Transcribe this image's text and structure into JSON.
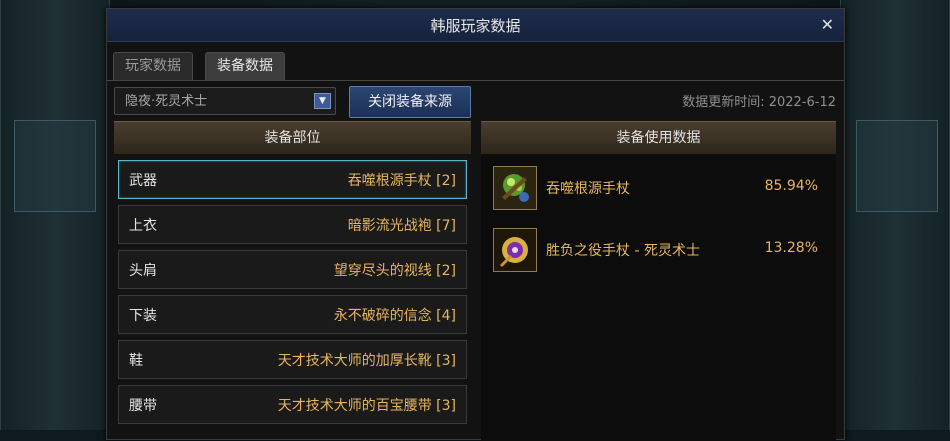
{
  "window": {
    "title": "韩服玩家数据",
    "close_glyph": "✕"
  },
  "tabs": [
    {
      "label": "玩家数据",
      "active": false
    },
    {
      "label": "装备数据",
      "active": true
    }
  ],
  "toolbar": {
    "class_select": {
      "value": "隐夜·死灵术士",
      "arrow_glyph": "▼"
    },
    "close_source_label": "关闭装备来源",
    "update_text": "数据更新时间: 2022-6-12"
  },
  "left_panel": {
    "header": "装备部位",
    "slots": [
      {
        "name": "武器",
        "item": "吞噬根源手杖 [2]",
        "selected": true
      },
      {
        "name": "上衣",
        "item": "暗影流光战袍 [7]",
        "selected": false
      },
      {
        "name": "头肩",
        "item": "望穿尽头的视线 [2]",
        "selected": false
      },
      {
        "name": "下装",
        "item": "永不破碎的信念 [4]",
        "selected": false
      },
      {
        "name": "鞋",
        "item": "天才技术大师的加厚长靴 [3]",
        "selected": false
      },
      {
        "name": "腰带",
        "item": "天才技术大师的百宝腰带 [3]",
        "selected": false
      }
    ]
  },
  "right_panel": {
    "header": "装备使用数据",
    "items": [
      {
        "name": "吞噬根源手杖",
        "percent": "85.94%",
        "icon": "staff-green-orb-icon"
      },
      {
        "name": "胜负之役手杖 - 死灵术士",
        "percent": "13.28%",
        "icon": "staff-gold-purple-icon"
      }
    ]
  },
  "colors": {
    "accent_gold": "#e8b55e",
    "selected_border": "#5fb5c8",
    "button_blue": "#2b4672"
  }
}
